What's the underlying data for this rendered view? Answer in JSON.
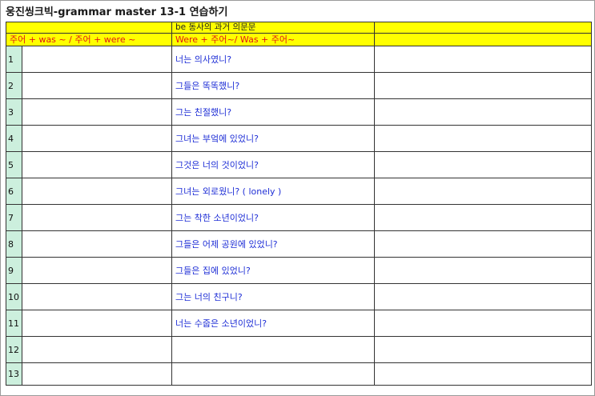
{
  "title": "웅진씽크빅-grammar master 13-1 연습하기",
  "header": {
    "section_label": "be 동사의 과거 의문문",
    "col_statement": "주어 + was ~ / 주어 + were ~",
    "col_question": "Were + 주어~/ Was + 주어~"
  },
  "colors": {
    "header_bg": "#ffff00",
    "header_red_text": "#e01515",
    "prompt_blue_text": "#1f2fd6",
    "number_bg": "#ccefdd"
  },
  "rows": [
    {
      "num": "1",
      "prompt": "너는 의사였니?"
    },
    {
      "num": "2",
      "prompt": "그들은 똑똑했니?"
    },
    {
      "num": "3",
      "prompt": "그는 친절했니?"
    },
    {
      "num": "4",
      "prompt": "그녀는 부엌에 있었니?"
    },
    {
      "num": "5",
      "prompt": "그것은 너의 것이었니?"
    },
    {
      "num": "6",
      "prompt": "그녀는 외로웠니? ( lonely )"
    },
    {
      "num": "7",
      "prompt": "그는 착한 소년이었니?"
    },
    {
      "num": "8",
      "prompt": "그들은 어제 공원에 있었니?"
    },
    {
      "num": "9",
      "prompt": "그들은 집에 있었니?"
    },
    {
      "num": "10",
      "prompt": "그는 너의 친구니?"
    },
    {
      "num": "11",
      "prompt": "너는 수줍은 소년이었니?"
    },
    {
      "num": "12",
      "prompt": ""
    },
    {
      "num": "13",
      "prompt": ""
    }
  ]
}
